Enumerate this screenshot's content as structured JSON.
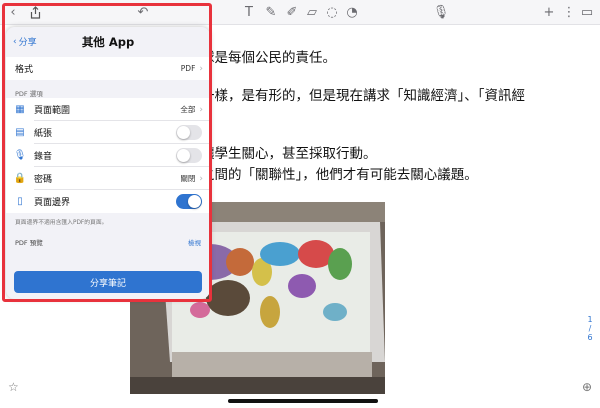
{
  "toolbar": {
    "icons": [
      "back-icon",
      "share-icon",
      "undo-icon",
      "text-icon",
      "pen-icon",
      "highlighter-icon",
      "eraser-icon",
      "lasso-icon",
      "shape-icon",
      "mic-icon",
      "add-icon",
      "more-icon",
      "pages-icon"
    ]
  },
  "note": {
    "lines": [
      "球是每個公民的責任。",
      "一樣，是有形的，但是現在講求「知識經濟」、「資訊經",
      "",
      "讓學生關心，甚至採取行動。",
      "之間的「關聯性」，他們才有可能去關心議題。"
    ]
  },
  "page_indicator": {
    "current": "1",
    "total": "6"
  },
  "popup": {
    "back_label": "分享",
    "title": "其他 App",
    "format_label": "格式",
    "format_value": "PDF",
    "section_pdf_options": "PDF 選項",
    "options": [
      {
        "icon": "grid-icon",
        "label": "頁面範圍",
        "value": "全部",
        "type": "disclosure"
      },
      {
        "icon": "paper-icon",
        "label": "紙張",
        "type": "toggle",
        "on": false
      },
      {
        "icon": "mic-icon",
        "label": "錄音",
        "type": "toggle",
        "on": false
      },
      {
        "icon": "lock-icon",
        "label": "密碼",
        "value": "關閉",
        "type": "disclosure"
      },
      {
        "icon": "page-border-icon",
        "label": "頁面邊界",
        "type": "toggle",
        "on": true
      }
    ],
    "border_note": "頁面邊界不適用含匯入PDF的頁面。",
    "preview_label": "PDF 預覽",
    "preview_action": "檢視",
    "share_button": "分享筆記"
  },
  "colors": {
    "accent": "#2f74d0",
    "highlight_frame": "#e8323c"
  }
}
